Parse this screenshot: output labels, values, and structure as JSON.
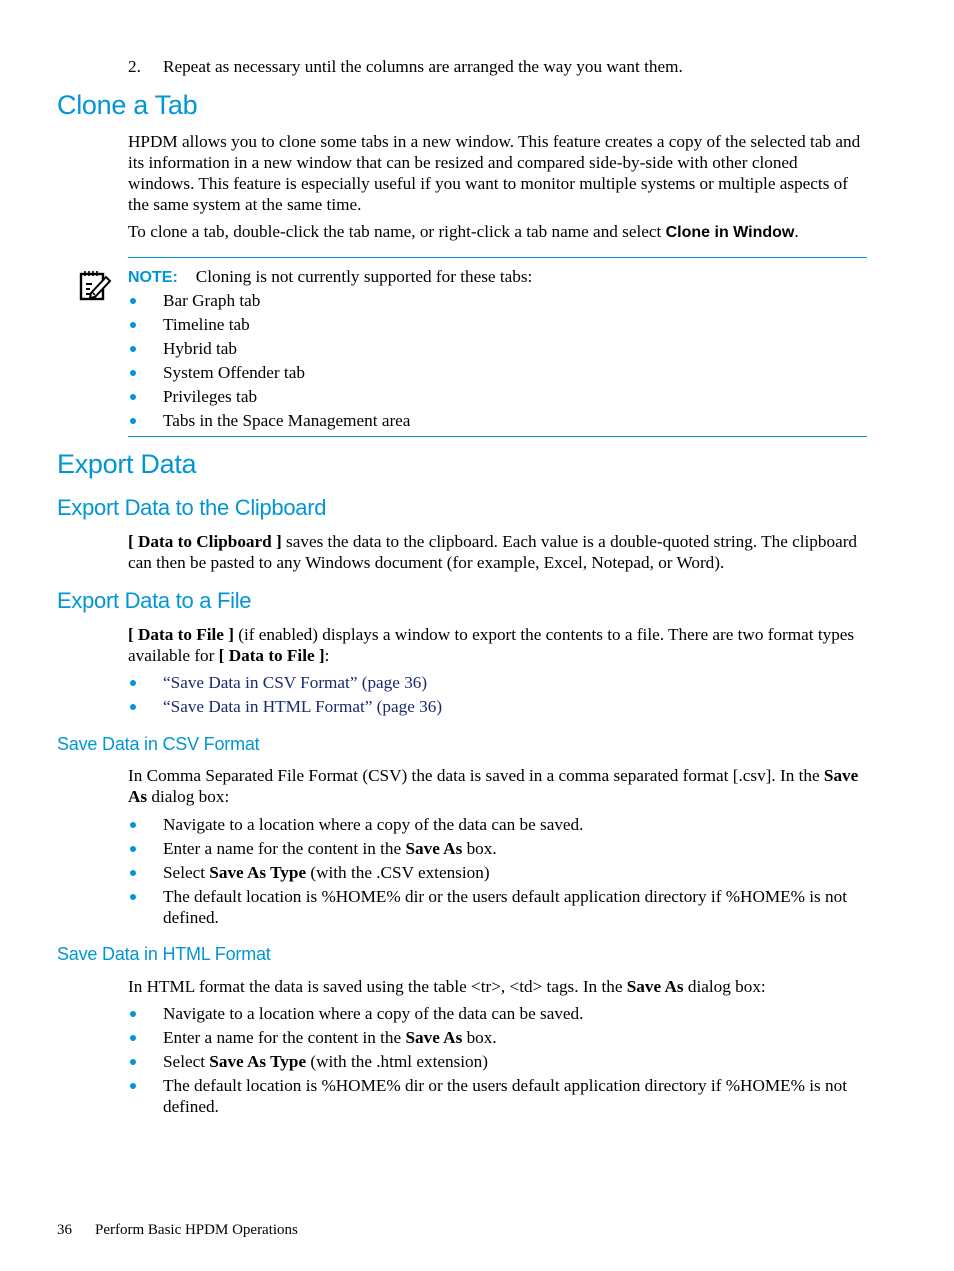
{
  "intro_step": {
    "number": "2.",
    "text": "Repeat as necessary until the columns are arranged the way you want them."
  },
  "clone_tab": {
    "heading": "Clone a Tab",
    "para1": "HPDM allows you to clone some tabs in a new window. This feature creates a copy of the selected tab and its information in a new window that can be resized and compared side-by-side with other cloned windows. This feature is especially useful if you want to monitor multiple systems or multiple aspects of the same system at the same time.",
    "para2_prefix": "To clone a tab, double-click the tab name, or right-click a tab name and select ",
    "para2_bold": "Clone in Window",
    "para2_suffix": ".",
    "note": {
      "icon": "note-pencil-icon",
      "label": "NOTE:",
      "text": "Cloning is not currently supported for these tabs:",
      "items": [
        "Bar Graph tab",
        "Timeline tab",
        "Hybrid tab",
        "System Offender tab",
        "Privileges tab",
        "Tabs in the Space Management area"
      ]
    }
  },
  "export_data": {
    "heading": "Export Data",
    "clipboard": {
      "heading": "Export Data to the Clipboard",
      "bold": "[ Data to Clipboard ]",
      "text": " saves the data to the clipboard. Each value is a double-quoted string. The clipboard can then be pasted to any Windows document (for example, Excel, Notepad, or Word)."
    },
    "file": {
      "heading": "Export Data to a File",
      "bold1": "[ Data to File ]",
      "text1": " (if enabled) displays a window to export the contents to a file. There are two format types available for ",
      "bold2": "[ Data to File ]",
      "text2": ":",
      "links": [
        "“Save Data in CSV Format” (page 36)",
        "“Save Data in HTML Format” (page 36)"
      ]
    },
    "csv": {
      "heading": "Save Data in CSV Format",
      "intro_prefix": "In Comma Separated File Format (CSV) the data is saved in a comma separated format [.csv]. In the ",
      "intro_bold": "Save As",
      "intro_suffix": " dialog box:",
      "items": [
        {
          "pre": "Navigate to a location where a copy of the data can be saved.",
          "bold": "",
          "post": ""
        },
        {
          "pre": "Enter a name for the content in the ",
          "bold": "Save As",
          "post": " box."
        },
        {
          "pre": "Select ",
          "bold": "Save As Type",
          "post": " (with the .CSV extension)"
        },
        {
          "pre": "The default location is %HOME% dir or the users default application directory if %HOME% is not defined.",
          "bold": "",
          "post": ""
        }
      ]
    },
    "html": {
      "heading": "Save Data in HTML Format",
      "intro_prefix": "In HTML format the data is saved using the table <tr>, <td> tags. In the ",
      "intro_bold": "Save As",
      "intro_suffix": " dialog box:",
      "items": [
        {
          "pre": "Navigate to a location where a copy of the data can be saved.",
          "bold": "",
          "post": ""
        },
        {
          "pre": "Enter a name for the content in the ",
          "bold": "Save As",
          "post": " box."
        },
        {
          "pre": "Select ",
          "bold": "Save As Type",
          "post": " (with the .html extension)"
        },
        {
          "pre": "The default location is %HOME% dir or the users default application directory if %HOME% is not defined.",
          "bold": "",
          "post": ""
        }
      ]
    }
  },
  "footer": {
    "page_number": "36",
    "title": "Perform Basic HPDM Operations"
  },
  "colors": {
    "accent": "#0096d6",
    "link": "#1a2a6c",
    "text": "#000000"
  }
}
